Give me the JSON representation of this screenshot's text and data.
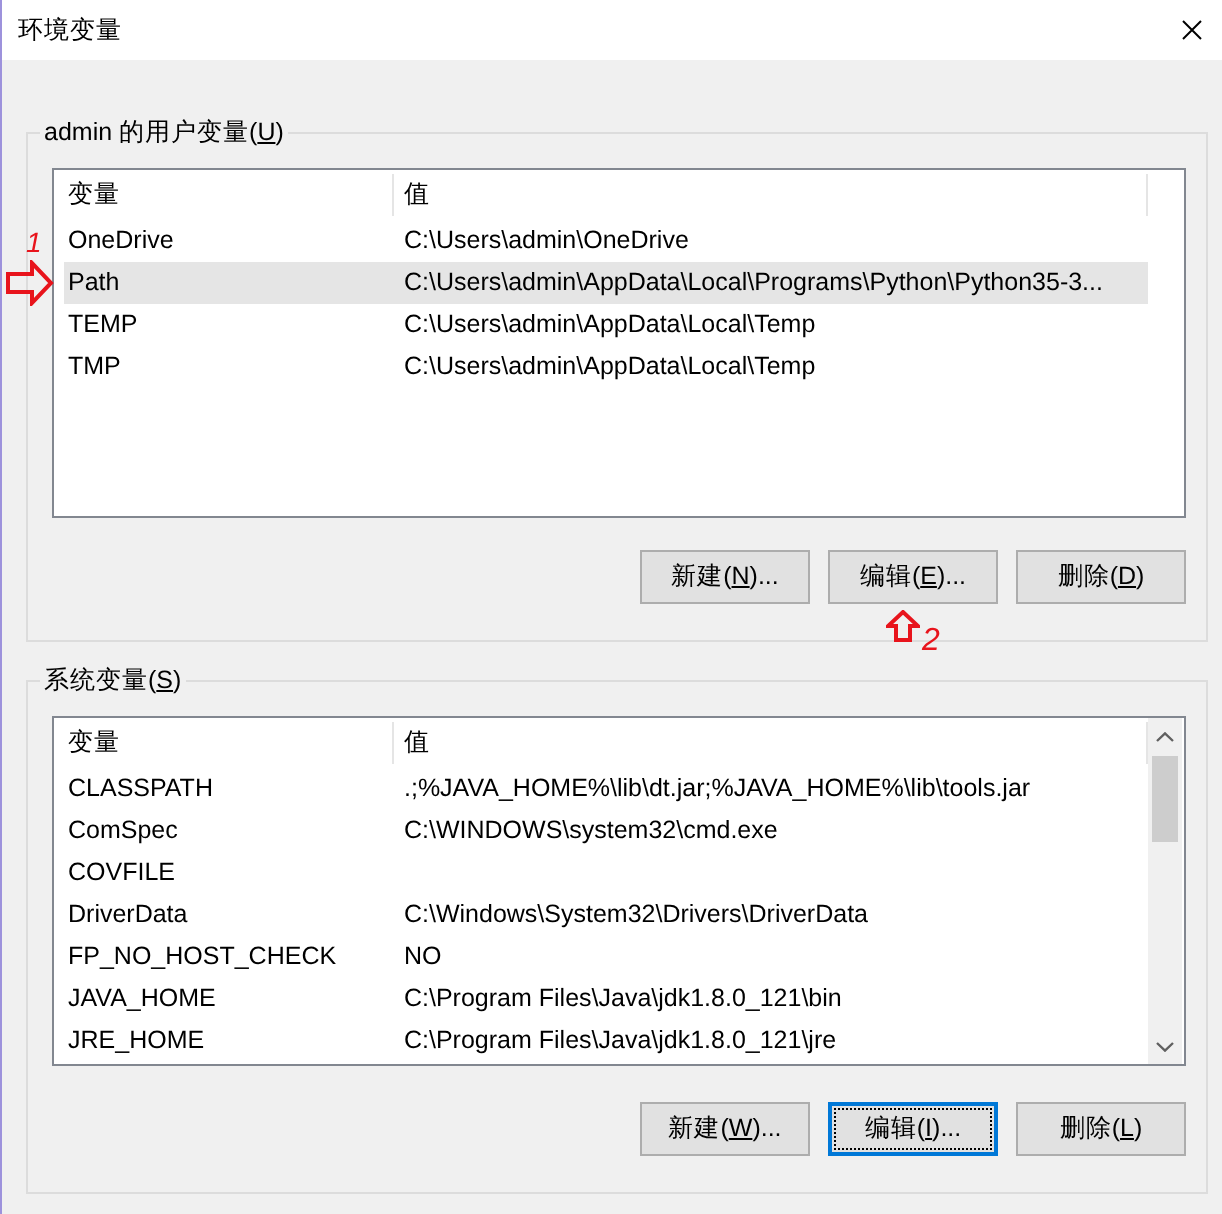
{
  "window": {
    "title": "环境变量"
  },
  "user_variables": {
    "legend": {
      "before": "admin 的用户变量(",
      "key": "U",
      "after": ")"
    },
    "columns": [
      "变量",
      "值"
    ],
    "scrollbar": false,
    "rows": [
      {
        "variable": "OneDrive",
        "value": "C:\\Users\\admin\\OneDrive",
        "selected": false
      },
      {
        "variable": "Path",
        "value": "C:\\Users\\admin\\AppData\\Local\\Programs\\Python\\Python35-3...",
        "selected": true
      },
      {
        "variable": "TEMP",
        "value": "C:\\Users\\admin\\AppData\\Local\\Temp",
        "selected": false
      },
      {
        "variable": "TMP",
        "value": "C:\\Users\\admin\\AppData\\Local\\Temp",
        "selected": false
      }
    ],
    "buttons": [
      {
        "before": "新建(",
        "key": "N",
        "after": ")...",
        "focused": false
      },
      {
        "before": "编辑(",
        "key": "E",
        "after": ")...",
        "focused": false
      },
      {
        "before": "删除(",
        "key": "D",
        "after": ")",
        "focused": false
      }
    ]
  },
  "system_variables": {
    "legend": {
      "before": "系统变量(",
      "key": "S",
      "after": ")"
    },
    "columns": [
      "变量",
      "值"
    ],
    "scrollbar": true,
    "rows": [
      {
        "variable": "CLASSPATH",
        "value": ".;%JAVA_HOME%\\lib\\dt.jar;%JAVA_HOME%\\lib\\tools.jar",
        "selected": false
      },
      {
        "variable": "ComSpec",
        "value": "C:\\WINDOWS\\system32\\cmd.exe",
        "selected": false
      },
      {
        "variable": "COVFILE",
        "selected": false
      },
      {
        "variable": "DriverData",
        "value": "C:\\Windows\\System32\\Drivers\\DriverData",
        "selected": false
      },
      {
        "variable": "FP_NO_HOST_CHECK",
        "value": "NO",
        "selected": false
      },
      {
        "variable": "JAVA_HOME",
        "value": "C:\\Program Files\\Java\\jdk1.8.0_121\\bin",
        "selected": false
      },
      {
        "variable": "JRE_HOME",
        "value": "C:\\Program Files\\Java\\jdk1.8.0_121\\jre",
        "selected": false
      }
    ],
    "buttons": [
      {
        "before": "新建(",
        "key": "W",
        "after": ")...",
        "focused": false
      },
      {
        "before": "编辑(",
        "key": "I",
        "after": ")...",
        "focused": true
      },
      {
        "before": "删除(",
        "key": "L",
        "after": ")",
        "focused": false
      }
    ]
  },
  "annotations": [
    {
      "kind": "arrow-right",
      "label": "1"
    },
    {
      "kind": "arrow-up",
      "label": "2"
    }
  ]
}
